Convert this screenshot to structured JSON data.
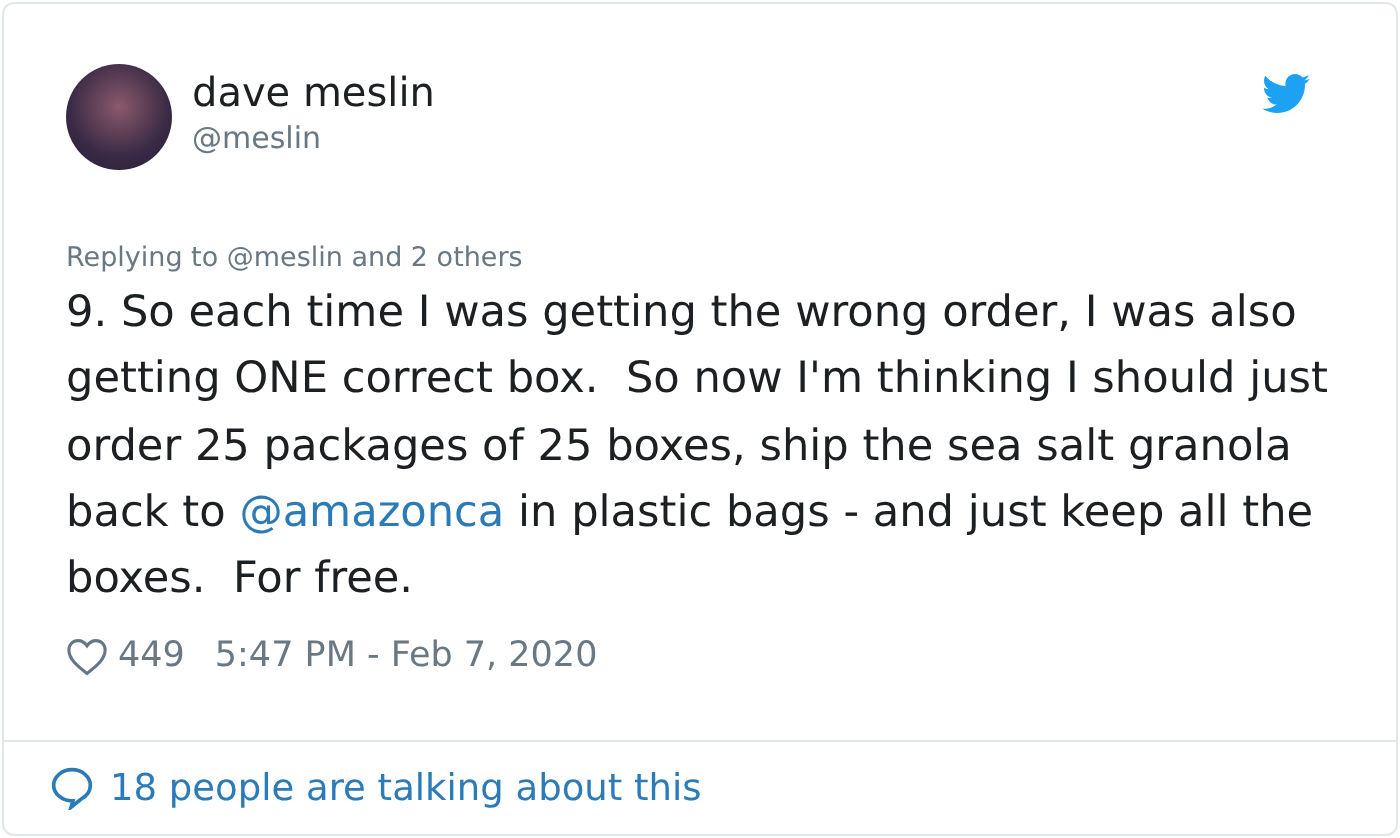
{
  "author": {
    "name": "dave meslin",
    "handle": "@meslin"
  },
  "reply_context": "Replying to @meslin and 2 others",
  "tweet": {
    "before": "9. So each time I was getting the wrong order, I was also getting ONE correct box.  So now I'm thinking I should just order 25 packages of 25 boxes, ship the sea salt granola back to ",
    "mention": "@amazonca",
    "after": " in plastic bags - and just keep all the boxes.  For free."
  },
  "likes": "449",
  "timestamp": "5:47 PM - Feb 7, 2020",
  "conversation": "18 people are talking about this"
}
